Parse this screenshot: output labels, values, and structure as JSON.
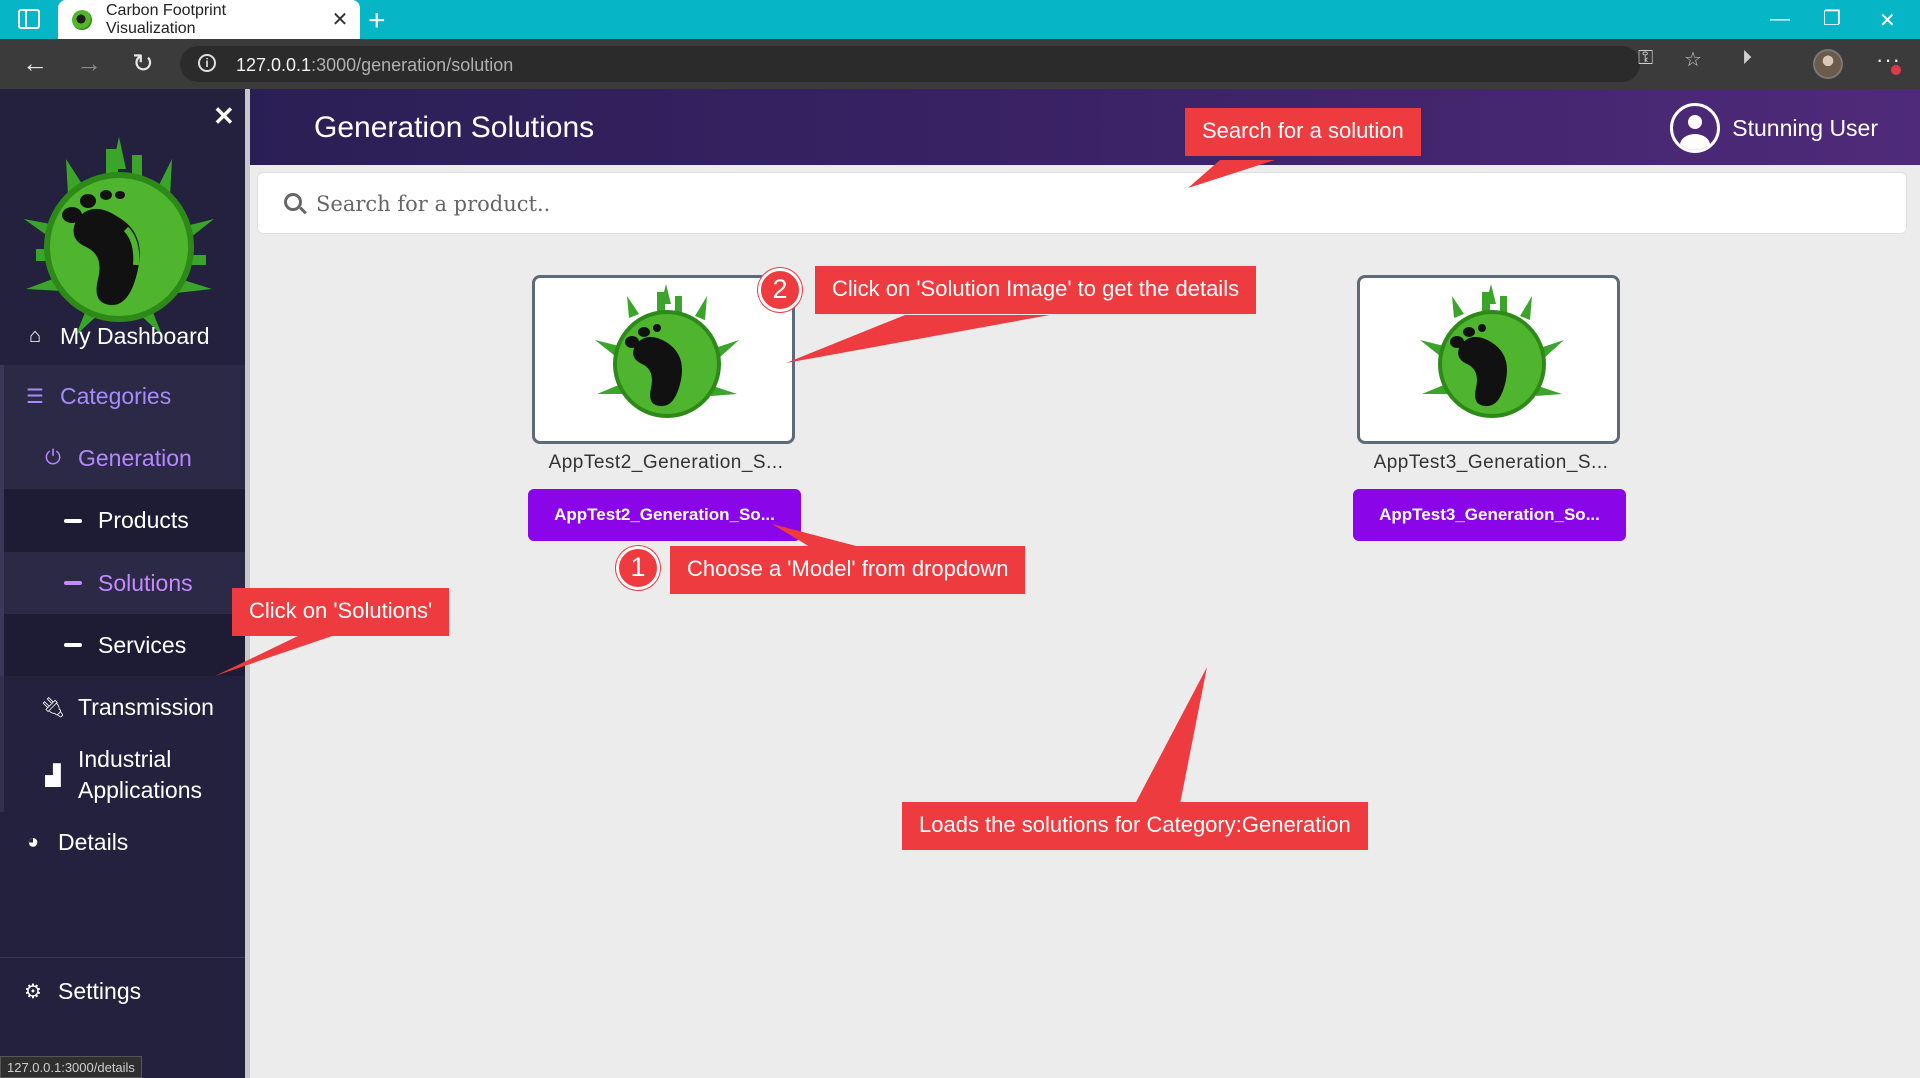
{
  "browser": {
    "tab_title": "Carbon Footprint Visualization",
    "url_host": "127.0.0.1",
    "url_path": ":3000/generation/solution",
    "status_url": "127.0.0.1:3000/details",
    "icons": [
      "sidebar-toggle-icon",
      "close-icon",
      "plus-icon",
      "back-icon",
      "forward-icon",
      "refresh-icon",
      "info-icon",
      "key-icon",
      "favorites-icon",
      "media-icon",
      "profile-avatar",
      "more-icon"
    ]
  },
  "sidebar": {
    "items": [
      {
        "label": "My Dashboard",
        "icon": "home-icon"
      },
      {
        "label": "Categories",
        "icon": "list-icon"
      },
      {
        "label": "Generation",
        "icon": "power-icon"
      },
      {
        "label": "Products",
        "icon": "dash-icon"
      },
      {
        "label": "Solutions",
        "icon": "dash-icon"
      },
      {
        "label": "Services",
        "icon": "dash-icon"
      },
      {
        "label": "Transmission",
        "icon": "plug-icon"
      },
      {
        "label": "Industrial Applications",
        "label_line1": "Industrial",
        "label_line2": "Applications",
        "icon": "factory-icon"
      },
      {
        "label": "Details",
        "icon": "pie-chart-icon"
      },
      {
        "label": "Settings",
        "icon": "gears-icon"
      }
    ],
    "active": "Solutions",
    "accent": "#a78bfa"
  },
  "header": {
    "title": "Generation Solutions",
    "user_name": "Stunning User"
  },
  "search": {
    "placeholder": "Search for a product.."
  },
  "solutions": [
    {
      "name": "AppTest2_Generation_S...",
      "button_label": "AppTest2_Generation_So..."
    },
    {
      "name": "AppTest3_Generation_S...",
      "button_label": "AppTest3_Generation_So..."
    }
  ],
  "annotations": {
    "search_hint": "Search for a solution",
    "step2_number": "2",
    "step2_text": "Click on 'Solution Image' to get the details",
    "step1_number": "1",
    "step1_text": "Choose a 'Model' from dropdown",
    "solutions_hint": "Click on 'Solutions'",
    "loads_hint": "Loads the solutions for Category:Generation",
    "color": "#ee3b3f"
  }
}
